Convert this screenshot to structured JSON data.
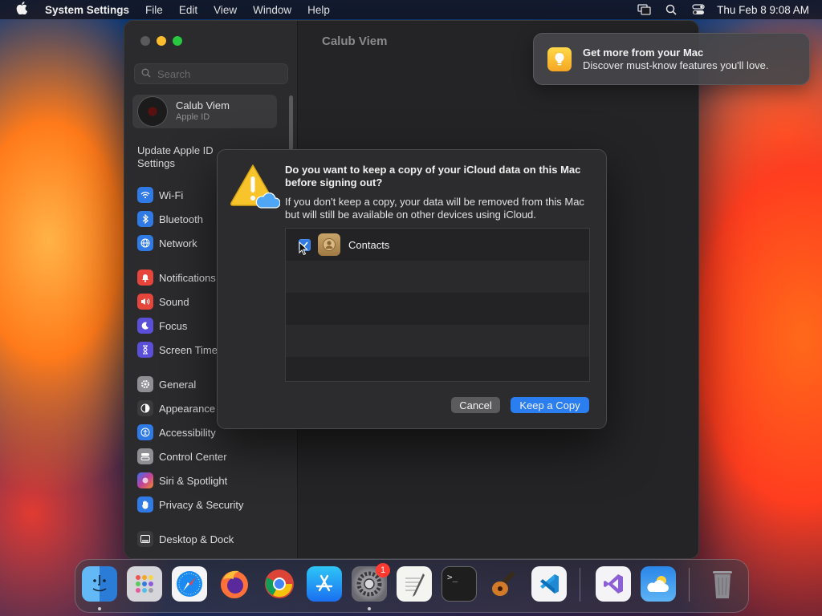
{
  "menubar": {
    "app_name": "System Settings",
    "menus": [
      "File",
      "Edit",
      "View",
      "Window",
      "Help"
    ],
    "clock": "Thu Feb 8  9:08 AM"
  },
  "window": {
    "title": "Calub Viem",
    "search_placeholder": "Search",
    "account": {
      "name": "Calub Viem",
      "subtitle": "Apple ID"
    },
    "update_label": "Update Apple ID Settings",
    "sidebar_items": [
      {
        "label": "Wi-Fi",
        "icon": "wifi-icon",
        "color": "#2f7ae5"
      },
      {
        "label": "Bluetooth",
        "icon": "bluetooth-icon",
        "color": "#2f7ae5"
      },
      {
        "label": "Network",
        "icon": "globe-icon",
        "color": "#2f7ae5"
      },
      {
        "label": "Notifications",
        "icon": "bell-icon",
        "color": "#e5453b"
      },
      {
        "label": "Sound",
        "icon": "speaker-icon",
        "color": "#e5453b"
      },
      {
        "label": "Focus",
        "icon": "moon-icon",
        "color": "#5b4fd8"
      },
      {
        "label": "Screen Time",
        "icon": "hourglass-icon",
        "color": "#5b4fd8"
      },
      {
        "label": "General",
        "icon": "gear-icon",
        "color": "#8e8e93"
      },
      {
        "label": "Appearance",
        "icon": "appearance-icon",
        "color": "#3a3a3c"
      },
      {
        "label": "Accessibility",
        "icon": "accessibility-icon",
        "color": "#2f7ae5"
      },
      {
        "label": "Control Center",
        "icon": "control-center-icon",
        "color": "#8e8e93"
      },
      {
        "label": "Siri & Spotlight",
        "icon": "siri-icon",
        "color": "#c2409c"
      },
      {
        "label": "Privacy & Security",
        "icon": "hand-icon",
        "color": "#2f7ae5"
      },
      {
        "label": "Desktop & Dock",
        "icon": "dock-icon",
        "color": "#3a3a3c"
      }
    ]
  },
  "notification": {
    "title": "Get more from your Mac",
    "body": "Discover must-know features you'll love."
  },
  "dialog": {
    "title": "Do you want to keep a copy of your iCloud data on this Mac before signing out?",
    "body": "If you don't keep a copy, your data will be removed from this Mac but will still be available on other devices using iCloud.",
    "items": [
      {
        "label": "Contacts",
        "checked": true
      }
    ],
    "cancel_label": "Cancel",
    "keep_label": "Keep a Copy"
  },
  "dock": {
    "apps": [
      "Finder",
      "Launchpad",
      "Safari",
      "Firefox",
      "Chrome",
      "App Store",
      "System Settings",
      "TextEdit",
      "Terminal",
      "GarageBand",
      "Visual Studio Code",
      "Visual Studio",
      "Weather",
      "Trash"
    ],
    "settings_badge": "1"
  }
}
